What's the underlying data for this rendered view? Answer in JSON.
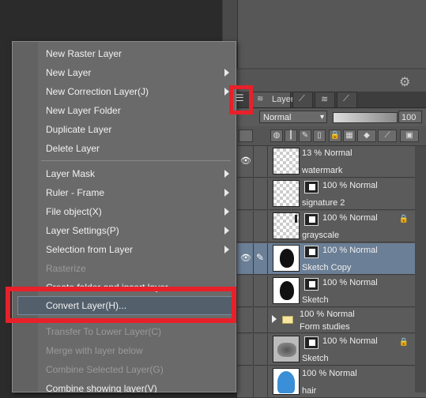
{
  "menu": {
    "items": [
      {
        "label": "New Raster Layer",
        "submenu": false,
        "disabled": false
      },
      {
        "label": "New Layer",
        "submenu": true,
        "disabled": false
      },
      {
        "label": "New Correction Layer(J)",
        "submenu": true,
        "disabled": false
      },
      {
        "label": "New Layer Folder",
        "submenu": false,
        "disabled": false
      },
      {
        "label": "Duplicate Layer",
        "submenu": false,
        "disabled": false
      },
      {
        "label": "Delete Layer",
        "submenu": false,
        "disabled": false
      },
      {
        "label": "Layer Mask",
        "submenu": true,
        "disabled": false
      },
      {
        "label": "Ruler - Frame",
        "submenu": true,
        "disabled": false
      },
      {
        "label": "File object(X)",
        "submenu": true,
        "disabled": false
      },
      {
        "label": "Layer Settings(P)",
        "submenu": true,
        "disabled": false
      },
      {
        "label": "Selection from Layer",
        "submenu": true,
        "disabled": false
      },
      {
        "label": "Rasterize",
        "submenu": false,
        "disabled": true
      },
      {
        "label": "Create folder and insert layer",
        "submenu": false,
        "disabled": false
      },
      {
        "label": "Convert Layer(H)...",
        "submenu": false,
        "disabled": false,
        "highlighted": true
      },
      {
        "label": "Transfer To Lower Layer(C)",
        "submenu": false,
        "disabled": true
      },
      {
        "label": "Merge with layer below",
        "submenu": false,
        "disabled": true
      },
      {
        "label": "Combine Selected Layer(G)",
        "submenu": false,
        "disabled": true
      },
      {
        "label": "Combine showing layer(V)",
        "submenu": false,
        "disabled": false
      }
    ]
  },
  "layer_panel": {
    "tab_label": "Layer",
    "blend_mode": "Normal",
    "opacity": "100",
    "layers": [
      {
        "props": "13 % Normal",
        "name": "watermark",
        "visible": true,
        "mask": false,
        "selected": false,
        "folder": false,
        "thumb": "checker",
        "lock": false
      },
      {
        "props": "100 % Normal",
        "name": "signature 2",
        "visible": false,
        "mask": true,
        "selected": false,
        "folder": false,
        "thumb": "checker",
        "lock": false
      },
      {
        "props": "100 % Normal",
        "name": "grayscale",
        "visible": false,
        "mask": true,
        "selected": false,
        "folder": false,
        "thumb": "checker",
        "lock": true
      },
      {
        "props": "100 % Normal",
        "name": "Sketch Copy",
        "visible": true,
        "mask": true,
        "selected": true,
        "folder": false,
        "thumb": "blob",
        "lock": false
      },
      {
        "props": "100 % Normal",
        "name": "Sketch",
        "visible": false,
        "mask": true,
        "selected": false,
        "folder": false,
        "thumb": "blob",
        "lock": false
      },
      {
        "props": "100 % Normal",
        "name": "Form studies",
        "visible": false,
        "mask": false,
        "selected": false,
        "folder": true,
        "thumb": "none",
        "lock": false
      },
      {
        "props": "100 % Normal",
        "name": "Sketch",
        "visible": false,
        "mask": true,
        "selected": false,
        "folder": false,
        "thumb": "sketch",
        "lock": true
      },
      {
        "props": "100 % Normal",
        "name": "hair",
        "visible": false,
        "mask": false,
        "selected": false,
        "folder": false,
        "thumb": "hair",
        "lock": false
      }
    ]
  },
  "colors": {
    "highlight_red": "#e8202a",
    "selected_row": "#6b7f96"
  }
}
